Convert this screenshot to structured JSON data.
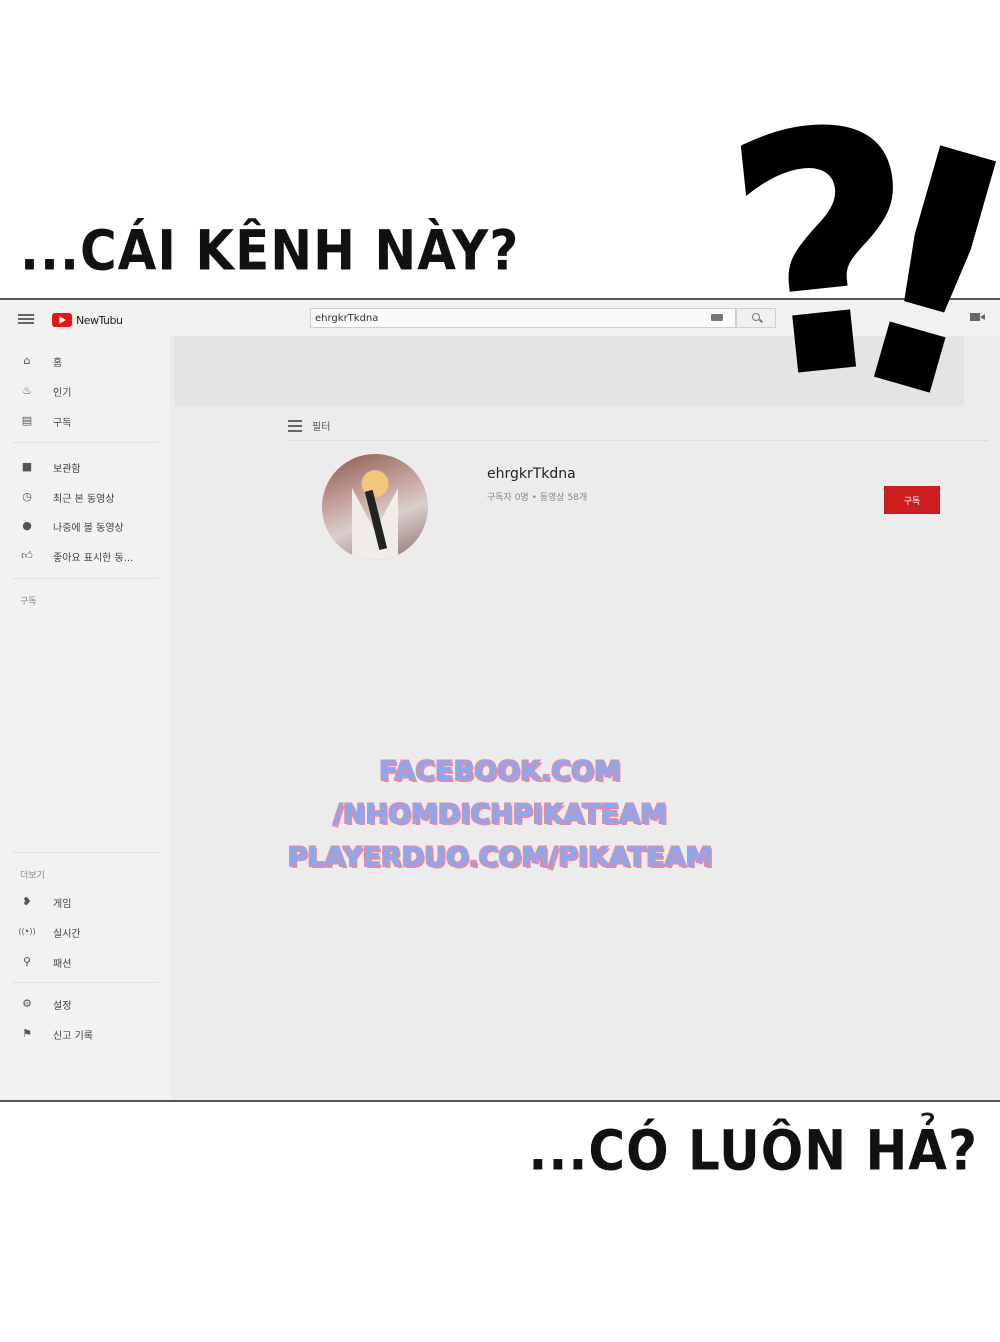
{
  "captions": {
    "top": "...CÁI KÊNH NÀY?",
    "bottom": "...CÓ LUÔN HẢ?",
    "question_mark": "?",
    "exclamation_mark": "!"
  },
  "app": {
    "logo_text": "NewTubu"
  },
  "search": {
    "value": "ehrgkrTkdna"
  },
  "sidebar": {
    "main_items": [
      {
        "icon": "home-icon",
        "label": "홈"
      },
      {
        "icon": "fire-icon",
        "label": "인기"
      },
      {
        "icon": "subscriptions-icon",
        "label": "구독"
      }
    ],
    "library_items": [
      {
        "icon": "folder-icon",
        "label": "보관함"
      },
      {
        "icon": "history-icon",
        "label": "최근 본 동영상"
      },
      {
        "icon": "clock-icon",
        "label": "나중에 볼 동영상"
      },
      {
        "icon": "thumbs-up-icon",
        "label": "좋아요 표시한 동..."
      }
    ],
    "subscriptions_heading": "구독",
    "more_heading": "더보기",
    "more_items": [
      {
        "icon": "gamepad-icon",
        "label": "게임"
      },
      {
        "icon": "live-icon",
        "label": "실시간"
      },
      {
        "icon": "hanger-icon",
        "label": "패션"
      }
    ],
    "settings_items": [
      {
        "icon": "gear-icon",
        "label": "설정"
      },
      {
        "icon": "flag-icon",
        "label": "신고 기록"
      }
    ]
  },
  "main": {
    "filter_label": "필터",
    "channel": {
      "name": "ehrgkrTkdna",
      "meta": "구독자 0명 • 동영상 58개",
      "subscribe_label": "구독"
    }
  },
  "watermark": {
    "lines": [
      "FACEBOOK.COM",
      "/NHOMDICHPIKATEAM",
      "PLAYERDUO.COM/PIKATEAM"
    ]
  },
  "colors": {
    "subscribe_red": "#cc1f1f",
    "logo_red": "#ee1111",
    "watermark_blue": "#8aa8ee",
    "watermark_pink": "#e58aa6"
  }
}
